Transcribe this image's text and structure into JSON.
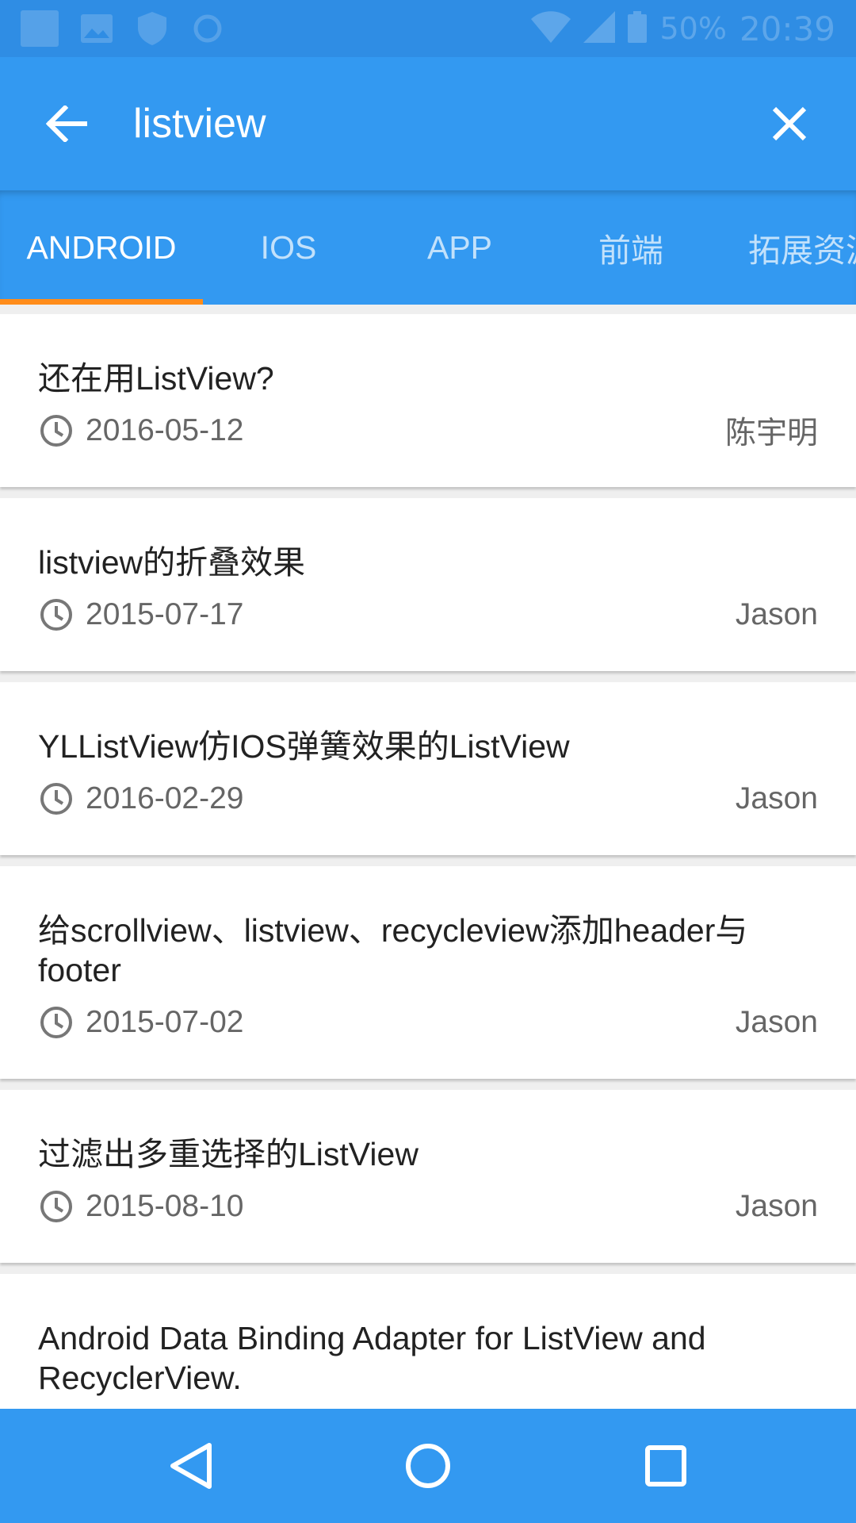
{
  "status_bar": {
    "battery_text": "50%",
    "time": "20:39",
    "icons": [
      "notification-square-icon",
      "image-icon",
      "shield-icon",
      "sync-icon",
      "wifi-icon",
      "signal-icon",
      "battery-icon"
    ]
  },
  "toolbar": {
    "back_icon": "arrow-left-icon",
    "search_value": "listview",
    "clear_icon": "close-icon"
  },
  "tabs": [
    {
      "label": "ANDROID",
      "active": true
    },
    {
      "label": "IOS",
      "active": false
    },
    {
      "label": "APP",
      "active": false
    },
    {
      "label": "前端",
      "active": false
    },
    {
      "label": "拓展资源",
      "active": false
    }
  ],
  "articles": [
    {
      "title": "还在用ListView?",
      "date": "2016-05-12",
      "author": "陈宇明"
    },
    {
      "title": "listview的折叠效果",
      "date": "2015-07-17",
      "author": "Jason"
    },
    {
      "title": "YLListView仿IOS弹簧效果的ListView",
      "date": "2016-02-29",
      "author": "Jason"
    },
    {
      "title": "给scrollview、listview、recycleview添加header与footer",
      "date": "2015-07-02",
      "author": "Jason"
    },
    {
      "title": "过滤出多重选择的ListView",
      "date": "2015-08-10",
      "author": "Jason"
    },
    {
      "title": "Android Data Binding Adapter for ListView and RecyclerView.",
      "date": "",
      "author": ""
    }
  ],
  "nav_bar": {
    "icons": [
      "nav-back-icon",
      "nav-home-icon",
      "nav-recent-icon"
    ]
  },
  "colors": {
    "primary": "#3399f1",
    "status_bar": "#2f8de4",
    "tab_indicator": "#ff8c1a",
    "card_background": "#ffffff",
    "page_background": "#efefef"
  }
}
